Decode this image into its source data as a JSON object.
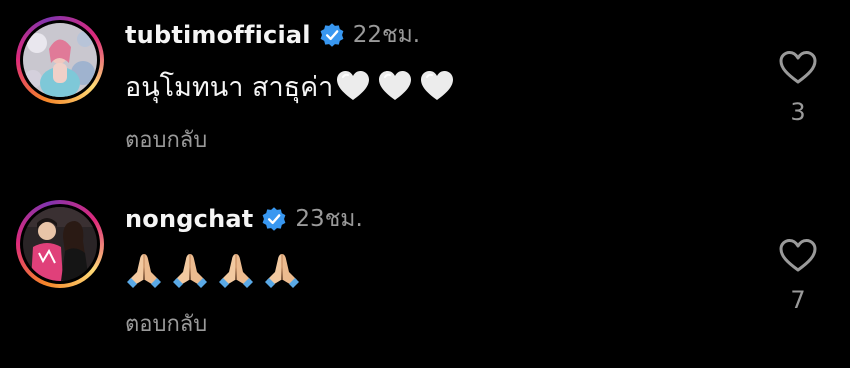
{
  "colors": {
    "background": "#000000",
    "text_primary": "#f5f5f5",
    "text_secondary": "#9a9a9a",
    "verified": "#3897f0",
    "heart_emoji": "#e8e8e8",
    "pray_emoji": "#f2c9a0",
    "pray_cuff": "#5aa9e6"
  },
  "comments": [
    {
      "username": "tubtimofficial",
      "verified": true,
      "time": "22ชม.",
      "text": "อนุโมทนา สาธุค่า",
      "emojis": [
        "white-heart",
        "white-heart",
        "white-heart"
      ],
      "reply_label": "ตอบกลับ",
      "like_icon": "heart-outline-icon",
      "like_count": "3"
    },
    {
      "username": "nongchat",
      "verified": true,
      "time": "23ชม.",
      "text": "",
      "emojis": [
        "folded-hands",
        "folded-hands",
        "folded-hands",
        "folded-hands"
      ],
      "reply_label": "ตอบกลับ",
      "like_icon": "heart-outline-icon",
      "like_count": "7"
    }
  ]
}
